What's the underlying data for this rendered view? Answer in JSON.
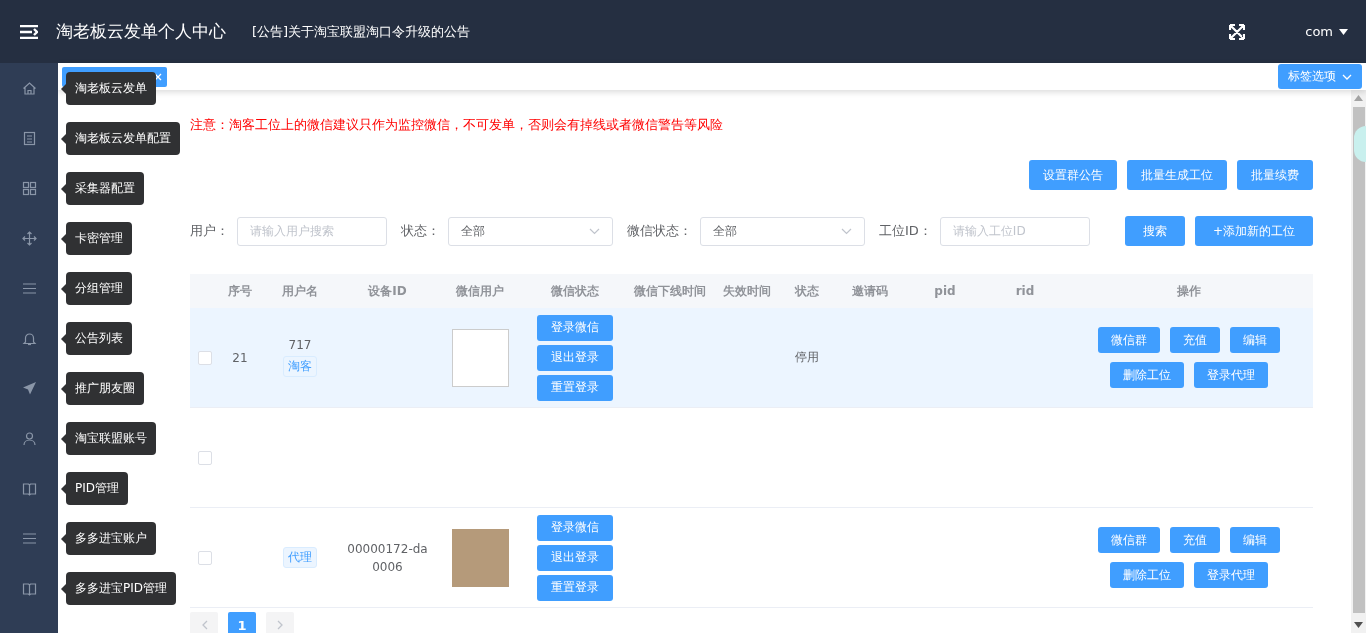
{
  "header": {
    "title": "淘老板云发单个人中心",
    "announcement": "[公告]关于淘宝联盟淘口令升级的公告",
    "user": "com"
  },
  "sidebar": {
    "items": [
      {
        "tooltip": "淘老板云发单"
      },
      {
        "tooltip": "淘老板云发单配置"
      },
      {
        "tooltip": "采集器配置"
      },
      {
        "tooltip": "卡密管理"
      },
      {
        "tooltip": "分组管理"
      },
      {
        "tooltip": "公告列表"
      },
      {
        "tooltip": "推广朋友圈"
      },
      {
        "tooltip": "淘宝联盟账号"
      },
      {
        "tooltip": "PID管理"
      },
      {
        "tooltip": "多多进宝账户"
      },
      {
        "tooltip": "多多进宝PID管理"
      }
    ]
  },
  "tab_bar": {
    "options_button": "标签选项"
  },
  "notice": "注意：淘客工位上的微信建议只作为监控微信，不可发单，否则会有掉线或者微信警告等风险",
  "toolbar_buttons": [
    "设置群公告",
    "批量生成工位",
    "批量续费"
  ],
  "filters": [
    {
      "kind": "input",
      "label": "用户：",
      "placeholder": "请输入用户搜索"
    },
    {
      "kind": "select",
      "label": "状态：",
      "value": "全部"
    },
    {
      "kind": "select",
      "label": "微信状态：",
      "value": "全部"
    },
    {
      "kind": "input",
      "label": "工位ID：",
      "placeholder": "请输入工位ID"
    }
  ],
  "filter_buttons": [
    "搜索",
    "+添加新的工位"
  ],
  "table": {
    "columns": [
      "序号",
      "用户名",
      "设备ID",
      "微信用户",
      "微信状态",
      "微信下线时间",
      "失效时间",
      "状态",
      "邀请码",
      "pid",
      "rid",
      "操作"
    ],
    "rows": [
      {
        "selected": true,
        "checked": false,
        "index": "21",
        "username": "717",
        "tag": "淘客",
        "avatar": {
          "kind": "empty"
        },
        "wechat_actions": [
          "登录微信",
          "退出登录",
          "重置登录"
        ],
        "status": "停用",
        "actions": [
          "微信群",
          "充值",
          "编辑",
          "删除工位",
          "登录代理"
        ]
      },
      {
        "selected": false,
        "checked": false
      },
      {
        "selected": false,
        "checked": false,
        "tag": "代理",
        "device_id": [
          "00000172-da",
          "0006"
        ],
        "avatar": {
          "kind": "photo"
        },
        "wechat_actions": [
          "登录微信",
          "退出登录",
          "重置登录"
        ],
        "actions": [
          "微信群",
          "充值",
          "编辑",
          "删除工位",
          "登录代理"
        ]
      }
    ]
  },
  "pagination": {
    "pages": [
      {
        "label": "1",
        "selected": true
      }
    ]
  }
}
